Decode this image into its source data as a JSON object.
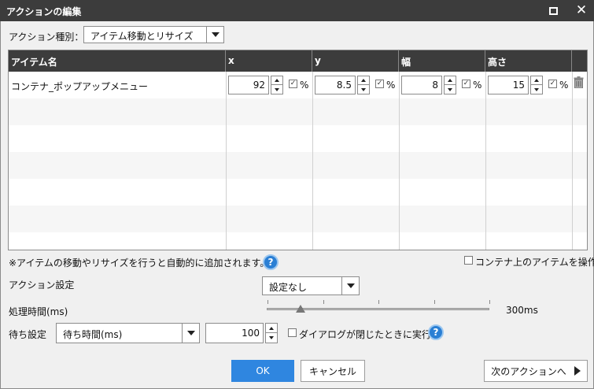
{
  "window": {
    "title": "アクションの編集"
  },
  "action_type": {
    "label": "アクション種別：",
    "value": "アイテム移動とリサイズ"
  },
  "table": {
    "headers": [
      "アイテム名",
      "x",
      "y",
      "幅",
      "高さ"
    ],
    "row": {
      "name": "コンテナ_ポップアップメニュー",
      "x": "92",
      "y": "8.5",
      "width": "8",
      "height": "15",
      "percent": "%"
    }
  },
  "note": "※アイテムの移動やリサイズを行うと自動的に追加されます。",
  "container_op": {
    "label": "コンテナ上のアイテムを操作",
    "checked": false
  },
  "action_setting": {
    "label": "アクション設定",
    "value": "設定なし"
  },
  "processing_time": {
    "label": "処理時間(ms)",
    "value_text": "300ms",
    "fraction": 0.15
  },
  "wait": {
    "label": "待ち設定",
    "mode": "待ち時間(ms)",
    "value": "100",
    "after_dialog_label": "ダイアログが閉じたときに実行",
    "after_dialog_checked": false
  },
  "help_icon_text": "?",
  "buttons": {
    "ok": "OK",
    "cancel": "キャンセル",
    "next": "次のアクションへ"
  },
  "colors": {
    "titlebar": "#3c3c3c",
    "accent": "#2f86e0",
    "help": "#2a7fd4"
  }
}
